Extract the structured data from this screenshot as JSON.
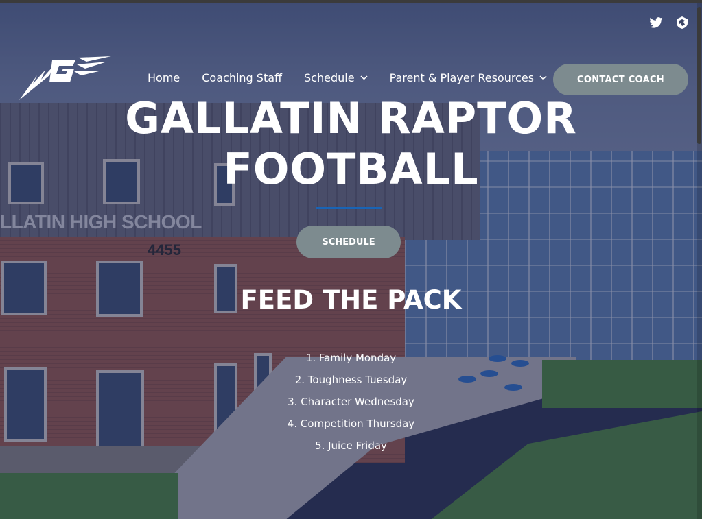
{
  "colors": {
    "accent_line": "#1a64b5",
    "button_bg": "#7d8b8f",
    "overlay": "#1c214e"
  },
  "topbar": {
    "social": [
      {
        "icon": "twitter-icon"
      },
      {
        "icon": "hudl-icon"
      }
    ]
  },
  "header": {
    "logo_icon": "raptor-g-logo",
    "nav": [
      {
        "label": "Home",
        "has_dropdown": false
      },
      {
        "label": "Coaching Staff",
        "has_dropdown": false
      },
      {
        "label": "Schedule",
        "has_dropdown": true
      },
      {
        "label": "Parent & Player Resources",
        "has_dropdown": true
      }
    ],
    "contact_button": "CONTACT COACH"
  },
  "hero": {
    "title_line1": "GALLATIN RAPTOR",
    "title_line2": "FOOTBALL",
    "schedule_button": "SCHEDULE",
    "subtitle": "FEED THE PACK",
    "days": [
      "1. Family Monday",
      "2. Toughness Tuesday",
      "3. Character Wednesday",
      "4. Competition Thursday",
      "5. Juice Friday"
    ]
  },
  "background": {
    "school_sign": "LLATIN HIGH SCHOOL",
    "address_number": "4455"
  }
}
